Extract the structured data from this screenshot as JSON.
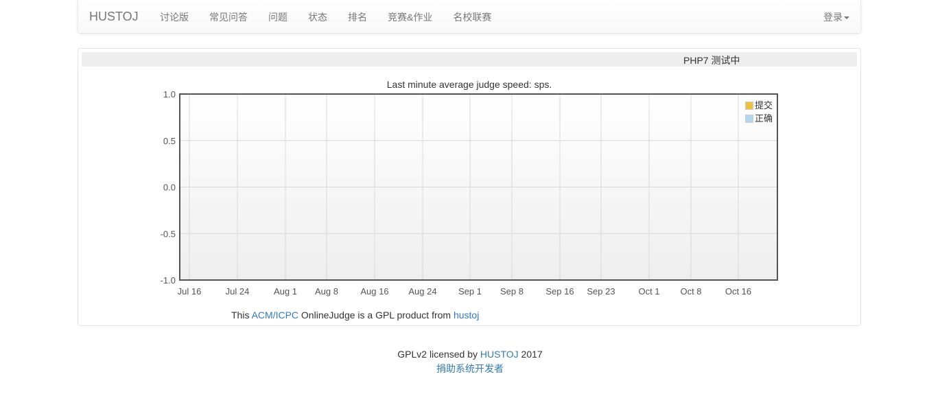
{
  "navbar": {
    "brand": "HUSTOJ",
    "links": [
      "讨论版",
      "常见问答",
      "问题",
      "状态",
      "排名",
      "竞赛&作业",
      "名校联赛"
    ],
    "login_label": "登录"
  },
  "marquee": {
    "text": "PHP7 测试中"
  },
  "chart_data": {
    "type": "line",
    "title": "Last minute average judge speed: sps.",
    "x": [
      "Jul 16",
      "Jul 24",
      "Aug 1",
      "Aug 8",
      "Aug 16",
      "Aug 24",
      "Sep 1",
      "Sep 8",
      "Sep 16",
      "Sep 23",
      "Oct 1",
      "Oct 8",
      "Oct 16"
    ],
    "ylim": [
      -1.0,
      1.0
    ],
    "yticks": [
      "1.0",
      "0.5",
      "0.0",
      "-0.5",
      "-1.0"
    ],
    "series": [
      {
        "name": "提交",
        "values": [],
        "color": "#f0c040"
      },
      {
        "name": "正确",
        "values": [],
        "color": "#b0d8f0"
      }
    ],
    "grid": true,
    "legend_position": "top-right"
  },
  "gpl_line": {
    "prefix": "This",
    "acm_link": "ACM/ICPC",
    "middle": "OnlineJudge is a GPL product from",
    "hustoj_link": "hustoj"
  },
  "footer": {
    "license_prefix": "GPLv2 licensed by",
    "license_link": "HUSTOJ",
    "year": "2017",
    "donate_link": "捐助系统开发者"
  },
  "colors": {
    "link": "#337ab7",
    "nav_text": "#777777",
    "marquee_bg": "#eeeeee"
  }
}
